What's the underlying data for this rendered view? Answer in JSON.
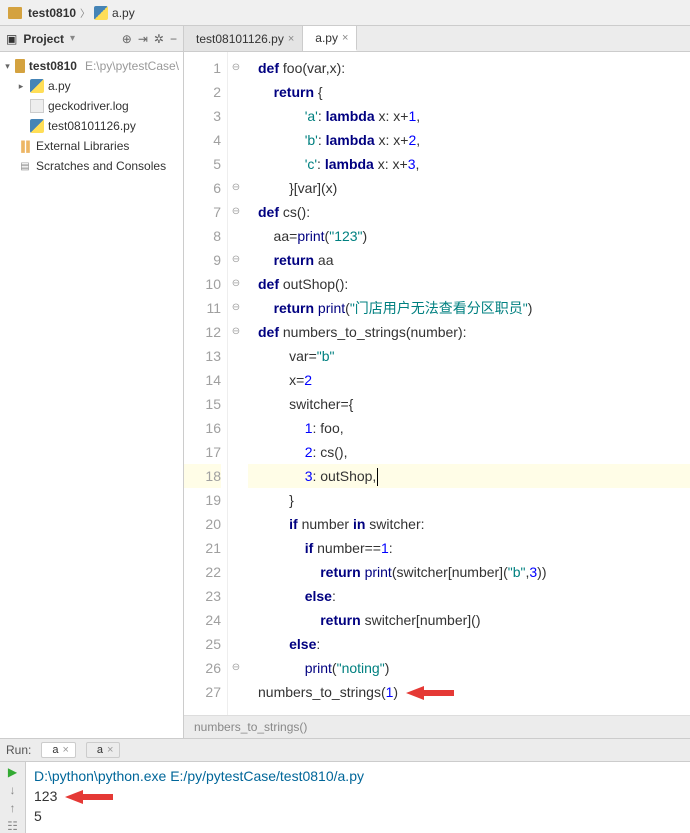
{
  "breadcrumb": {
    "root": "test0810",
    "file": "a.py"
  },
  "sidebar": {
    "title": "Project",
    "items": [
      {
        "depth": 0,
        "exp": "▾",
        "icon": "folder",
        "label": "test0810",
        "hint": "E:\\py\\pytestCase\\"
      },
      {
        "depth": 1,
        "exp": "▸",
        "icon": "py",
        "label": "a.py",
        "hint": ""
      },
      {
        "depth": 1,
        "exp": "",
        "icon": "log",
        "label": "geckodriver.log",
        "hint": ""
      },
      {
        "depth": 1,
        "exp": "",
        "icon": "py",
        "label": "test08101126.py",
        "hint": ""
      },
      {
        "depth": 0,
        "exp": "",
        "icon": "lib",
        "label": "External Libraries",
        "hint": ""
      },
      {
        "depth": 0,
        "exp": "",
        "icon": "scr",
        "label": "Scratches and Consoles",
        "hint": ""
      }
    ]
  },
  "tabs": [
    {
      "label": "test08101126.py",
      "active": false
    },
    {
      "label": "a.py",
      "active": true
    }
  ],
  "code": {
    "lines": [
      {
        "n": 1,
        "fold": "⊖",
        "ind": 0,
        "segs": [
          {
            "t": "def ",
            "c": "kw"
          },
          {
            "t": "foo(var,x):",
            "c": ""
          }
        ]
      },
      {
        "n": 2,
        "fold": "",
        "ind": 1,
        "segs": [
          {
            "t": "return ",
            "c": "kw"
          },
          {
            "t": "{",
            "c": ""
          }
        ]
      },
      {
        "n": 3,
        "fold": "",
        "ind": 3,
        "segs": [
          {
            "t": "'a'",
            "c": "str"
          },
          {
            "t": ": ",
            "c": ""
          },
          {
            "t": "lambda ",
            "c": "kw"
          },
          {
            "t": "x: x+",
            "c": ""
          },
          {
            "t": "1",
            "c": "num"
          },
          {
            "t": ",",
            "c": ""
          }
        ]
      },
      {
        "n": 4,
        "fold": "",
        "ind": 3,
        "segs": [
          {
            "t": "'b'",
            "c": "str"
          },
          {
            "t": ": ",
            "c": ""
          },
          {
            "t": "lambda ",
            "c": "kw"
          },
          {
            "t": "x: x+",
            "c": ""
          },
          {
            "t": "2",
            "c": "num"
          },
          {
            "t": ",",
            "c": ""
          }
        ]
      },
      {
        "n": 5,
        "fold": "",
        "ind": 3,
        "segs": [
          {
            "t": "'c'",
            "c": "str"
          },
          {
            "t": ": ",
            "c": ""
          },
          {
            "t": "lambda ",
            "c": "kw"
          },
          {
            "t": "x: x+",
            "c": ""
          },
          {
            "t": "3",
            "c": "num"
          },
          {
            "t": ",",
            "c": ""
          }
        ]
      },
      {
        "n": 6,
        "fold": "⊖",
        "ind": 2,
        "segs": [
          {
            "t": "}[var](x)",
            "c": ""
          }
        ]
      },
      {
        "n": 7,
        "fold": "⊖",
        "ind": 0,
        "segs": [
          {
            "t": "def ",
            "c": "kw"
          },
          {
            "t": "cs():",
            "c": ""
          }
        ]
      },
      {
        "n": 8,
        "fold": "",
        "ind": 1,
        "segs": [
          {
            "t": "aa=",
            "c": ""
          },
          {
            "t": "print",
            "c": "bi"
          },
          {
            "t": "(",
            "c": ""
          },
          {
            "t": "\"123\"",
            "c": "str"
          },
          {
            "t": ")",
            "c": ""
          }
        ]
      },
      {
        "n": 9,
        "fold": "⊖",
        "ind": 1,
        "segs": [
          {
            "t": "return ",
            "c": "kw"
          },
          {
            "t": "aa",
            "c": ""
          }
        ]
      },
      {
        "n": 10,
        "fold": "⊖",
        "ind": 0,
        "segs": [
          {
            "t": "def ",
            "c": "kw"
          },
          {
            "t": "outShop():",
            "c": ""
          }
        ]
      },
      {
        "n": 11,
        "fold": "⊖",
        "ind": 1,
        "segs": [
          {
            "t": "return ",
            "c": "kw"
          },
          {
            "t": "print",
            "c": "bi"
          },
          {
            "t": "(",
            "c": ""
          },
          {
            "t": "\"门店用户无法查看分区职员\"",
            "c": "str"
          },
          {
            "t": ")",
            "c": ""
          }
        ]
      },
      {
        "n": 12,
        "fold": "⊖",
        "ind": 0,
        "segs": [
          {
            "t": "def ",
            "c": "kw"
          },
          {
            "t": "numbers_to_strings(number):",
            "c": ""
          }
        ]
      },
      {
        "n": 13,
        "fold": "",
        "ind": 2,
        "segs": [
          {
            "t": "var=",
            "c": ""
          },
          {
            "t": "\"b\"",
            "c": "str"
          }
        ]
      },
      {
        "n": 14,
        "fold": "",
        "ind": 2,
        "segs": [
          {
            "t": "x=",
            "c": ""
          },
          {
            "t": "2",
            "c": "num"
          }
        ]
      },
      {
        "n": 15,
        "fold": "",
        "ind": 2,
        "segs": [
          {
            "t": "switcher={",
            "c": ""
          }
        ]
      },
      {
        "n": 16,
        "fold": "",
        "ind": 3,
        "segs": [
          {
            "t": "1",
            "c": "num"
          },
          {
            "t": ": foo,",
            "c": ""
          }
        ]
      },
      {
        "n": 17,
        "fold": "",
        "ind": 3,
        "segs": [
          {
            "t": "2",
            "c": "num"
          },
          {
            "t": ": cs(),",
            "c": ""
          }
        ]
      },
      {
        "n": 18,
        "fold": "",
        "ind": 3,
        "cur": true,
        "caret": true,
        "segs": [
          {
            "t": "3",
            "c": "num"
          },
          {
            "t": ": outShop,",
            "c": ""
          }
        ]
      },
      {
        "n": 19,
        "fold": "",
        "ind": 2,
        "segs": [
          {
            "t": "}",
            "c": ""
          }
        ]
      },
      {
        "n": 20,
        "fold": "",
        "ind": 2,
        "segs": [
          {
            "t": "if ",
            "c": "kw"
          },
          {
            "t": "number ",
            "c": ""
          },
          {
            "t": "in ",
            "c": "kw"
          },
          {
            "t": "switcher:",
            "c": ""
          }
        ]
      },
      {
        "n": 21,
        "fold": "",
        "ind": 3,
        "segs": [
          {
            "t": "if ",
            "c": "kw"
          },
          {
            "t": "number==",
            "c": ""
          },
          {
            "t": "1",
            "c": "num"
          },
          {
            "t": ":",
            "c": ""
          }
        ]
      },
      {
        "n": 22,
        "fold": "",
        "ind": 4,
        "segs": [
          {
            "t": "return ",
            "c": "kw"
          },
          {
            "t": "print",
            "c": "bi"
          },
          {
            "t": "(switcher[number](",
            "c": ""
          },
          {
            "t": "\"b\"",
            "c": "str"
          },
          {
            "t": ",",
            "c": ""
          },
          {
            "t": "3",
            "c": "num"
          },
          {
            "t": "))",
            "c": ""
          }
        ]
      },
      {
        "n": 23,
        "fold": "",
        "ind": 3,
        "segs": [
          {
            "t": "else",
            "c": "kw"
          },
          {
            "t": ":",
            "c": ""
          }
        ]
      },
      {
        "n": 24,
        "fold": "",
        "ind": 4,
        "segs": [
          {
            "t": "return ",
            "c": "kw"
          },
          {
            "t": "switcher[number]()",
            "c": ""
          }
        ]
      },
      {
        "n": 25,
        "fold": "",
        "ind": 2,
        "segs": [
          {
            "t": "else",
            "c": "kw"
          },
          {
            "t": ":",
            "c": ""
          }
        ]
      },
      {
        "n": 26,
        "fold": "⊖",
        "ind": 3,
        "segs": [
          {
            "t": "print",
            "c": "bi"
          },
          {
            "t": "(",
            "c": ""
          },
          {
            "t": "\"noting\"",
            "c": "str"
          },
          {
            "t": ")",
            "c": ""
          }
        ]
      },
      {
        "n": 27,
        "fold": "",
        "ind": 0,
        "arrow": true,
        "segs": [
          {
            "t": "numbers_to_strings(",
            "c": ""
          },
          {
            "t": "1",
            "c": "num"
          },
          {
            "t": ")",
            "c": ""
          }
        ]
      }
    ],
    "breadcrumb": "numbers_to_strings()"
  },
  "run": {
    "label": "Run:",
    "tabs": [
      {
        "label": "a",
        "active": true
      },
      {
        "label": "a",
        "active": false
      }
    ],
    "lines": {
      "cmd": "D:\\python\\python.exe E:/py/pytestCase/test0810/a.py",
      "out1": "123",
      "out2": "5"
    }
  }
}
